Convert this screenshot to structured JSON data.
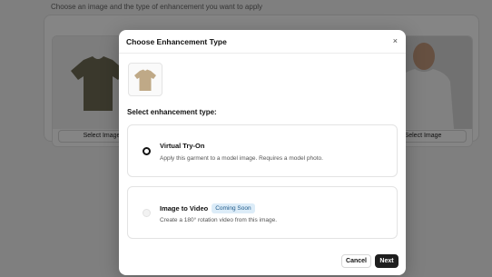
{
  "background": {
    "instruction": "Choose an image and the type of enhancement you want to apply",
    "tiles": [
      {
        "button_label": "Select Image"
      },
      {
        "button_label": "Select Image"
      }
    ]
  },
  "modal": {
    "title": "Choose Enhancement Type",
    "close_icon": "×",
    "section_label": "Select enhancement type:",
    "options": [
      {
        "title": "Virtual Try-On",
        "description": "Apply this garment to a model image. Requires a model photo.",
        "selected": true
      },
      {
        "title": "Image to Video",
        "badge": "Coming Soon",
        "description": "Create a 180° rotation video from this image.",
        "disabled": true
      }
    ],
    "cancel_label": "Cancel",
    "next_label": "Next"
  },
  "colors": {
    "overlay": "#000000",
    "primary_button": "#1e1e1e",
    "badge_bg": "#dcecf8",
    "badge_text": "#1f5a8a",
    "tshirt": "#bfa987"
  }
}
